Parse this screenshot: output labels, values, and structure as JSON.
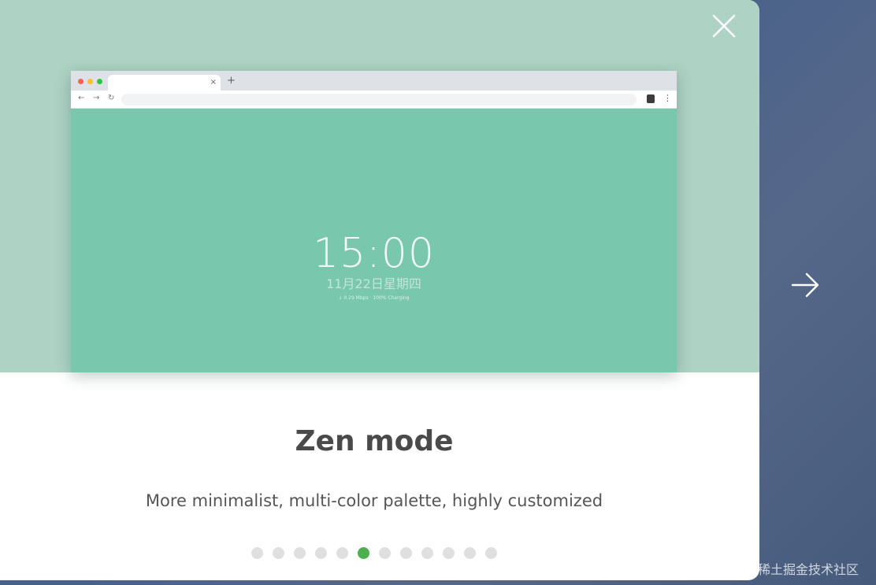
{
  "modal": {
    "close_icon": "close-icon",
    "next_icon": "arrow-right-icon"
  },
  "preview": {
    "tab_close": "×",
    "new_tab": "+",
    "nav_back": "←",
    "nav_forward": "→",
    "nav_reload": "↻",
    "menu": "⋮",
    "clock_time": "15:00",
    "date": "11月22日星期四",
    "status": "↓ 0.29 Mbps · 100% Charging"
  },
  "slide": {
    "title": "Zen mode",
    "description": "More minimalist, multi-color palette, highly customized",
    "total": 12,
    "active_index": 5
  },
  "colors": {
    "hero_bg": "#aed3c5",
    "preview_bg": "#79c7ac",
    "active_dot": "#4caf50",
    "inactive_dot": "#dfdfdf"
  },
  "watermark": "@稀土掘金技术社区"
}
